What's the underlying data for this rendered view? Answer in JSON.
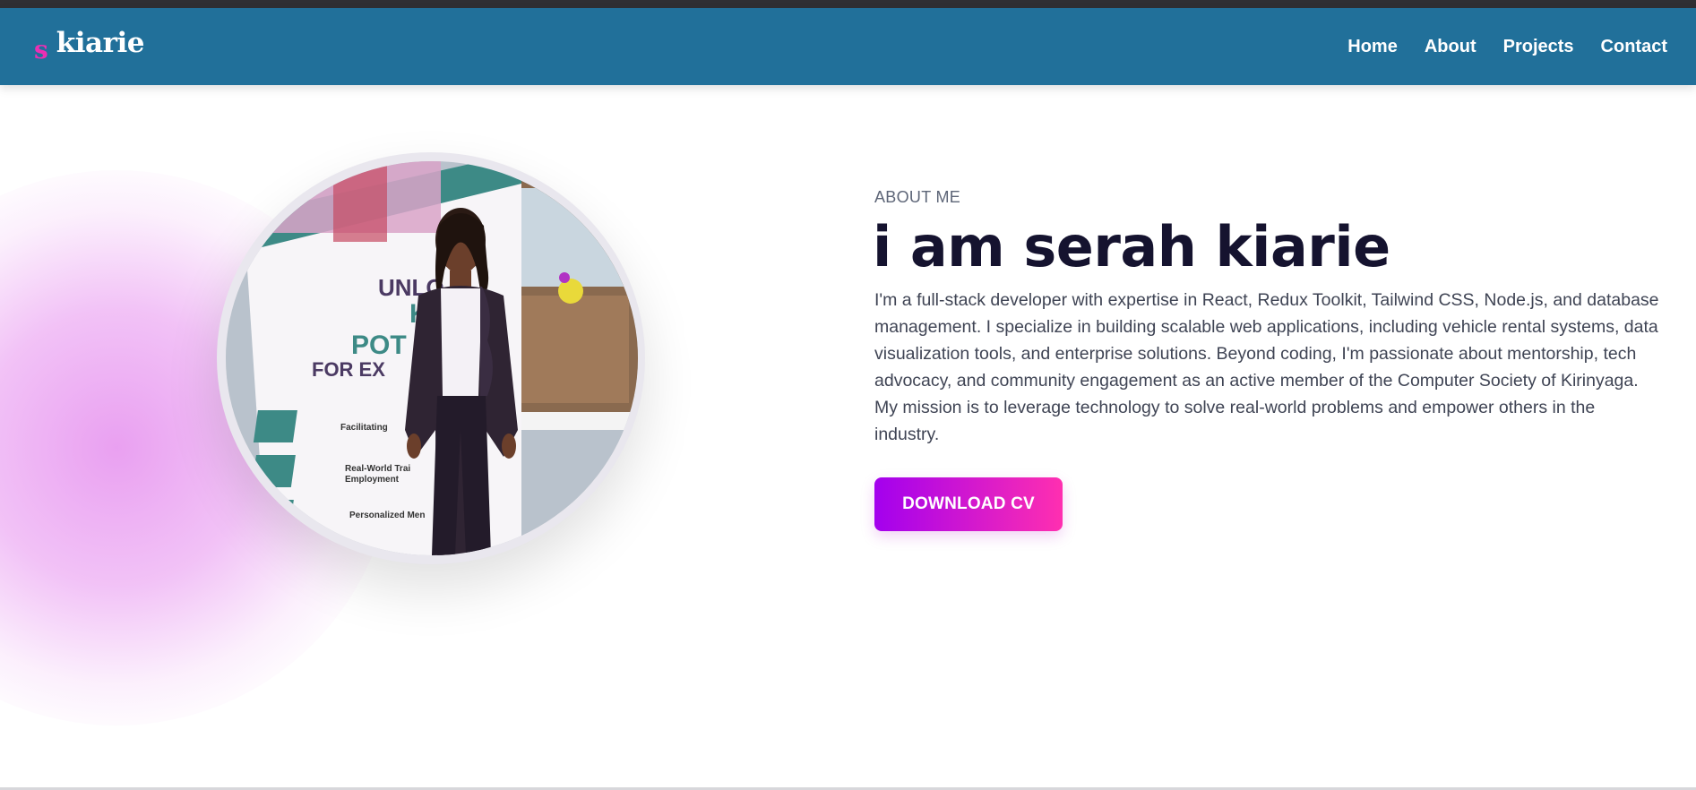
{
  "navbar": {
    "brand_initial": "s",
    "brand_name": "kiarie",
    "links": [
      "Home",
      "About",
      "Projects",
      "Contact"
    ]
  },
  "hero": {
    "section_label": "ABOUT ME",
    "headline": "i am serah kiarie",
    "bio": "I'm a full-stack developer with expertise in React, Redux Toolkit, Tailwind CSS, Node.js, and database management. I specialize in building scalable web applications, including vehicle rental systems, data visualization tools, and enterprise solutions. Beyond coding, I'm passionate about mentorship, tech advocacy, and community engagement as an active member of the Computer Society of Kirinyaga. My mission is to leverage technology to solve real-world problems and empower others in the industry.",
    "cta_label": "DOWNLOAD CV",
    "photo_banner": {
      "line1": "UNLO",
      "line2": "KE",
      "line3": "POT",
      "line4": "FOR EX",
      "items": [
        "Facilitating",
        "Real-World Trai",
        "Employment",
        "Personalized Men"
      ]
    }
  },
  "colors": {
    "navbar": "#21709a",
    "brand_accent": "#ec2fb3",
    "headline": "#15132f",
    "cta_gradient_start": "#a300ee",
    "cta_gradient_end": "#ff2fb0"
  }
}
